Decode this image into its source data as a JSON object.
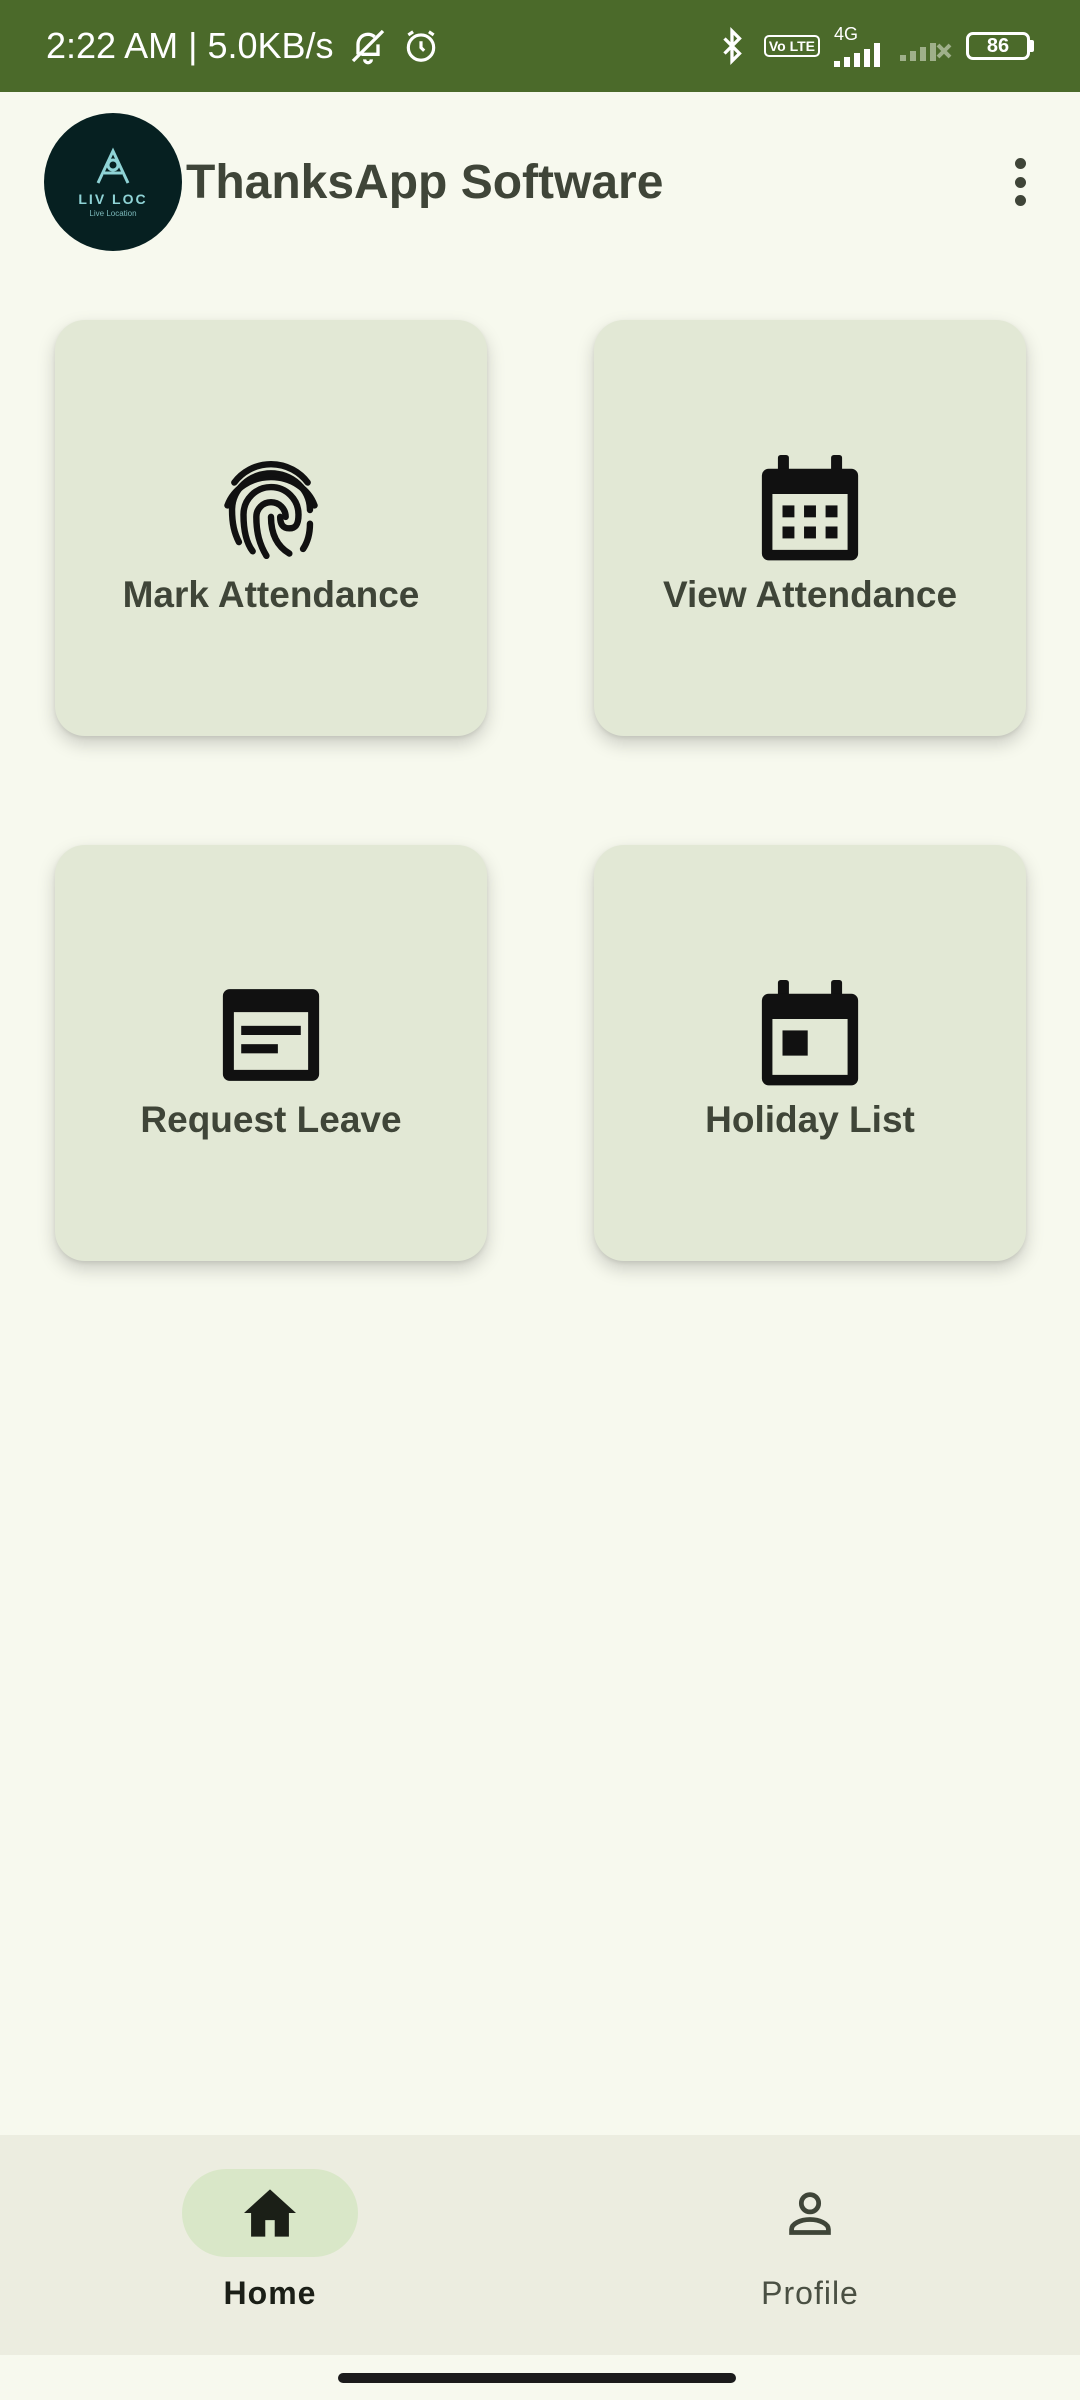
{
  "status_bar": {
    "time": "2:22 AM | 5.0KB/s",
    "network": "4G",
    "volte": "Vo LTE",
    "battery": "86",
    "icons": [
      "notifications-off-icon",
      "alarm-icon",
      "bluetooth-icon",
      "volte-icon",
      "signal-icon",
      "signal-no-service-icon",
      "battery-icon"
    ]
  },
  "app_bar": {
    "logo_text": "LIV LOC",
    "logo_tagline": "Live Location",
    "title": "ThanksApp Software",
    "menu_icon": "more-vert-icon"
  },
  "cards": [
    {
      "label": "Mark Attendance",
      "icon": "fingerprint-icon"
    },
    {
      "label": "View Attendance",
      "icon": "calendar-month-icon"
    },
    {
      "label": "Request Leave",
      "icon": "document-icon"
    },
    {
      "label": "Holiday List",
      "icon": "event-icon"
    }
  ],
  "bottom_nav": {
    "items": [
      {
        "label": "Home",
        "icon": "home-icon",
        "active": true
      },
      {
        "label": "Profile",
        "icon": "person-icon",
        "active": false
      }
    ]
  },
  "colors": {
    "status_bar": "#4b6a2a",
    "background": "#f7f9ee",
    "card": "#e2e8d5",
    "nav_active_pill": "#d9e7c8",
    "text": "#3f4538"
  }
}
